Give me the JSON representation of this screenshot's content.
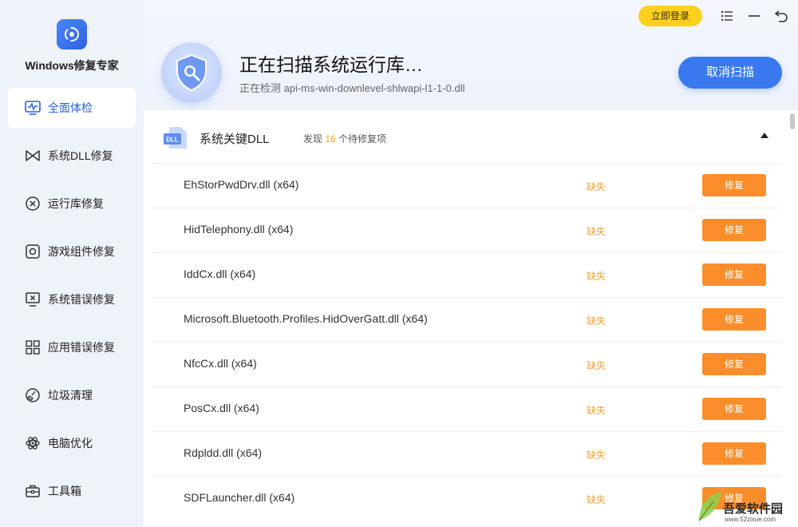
{
  "app": {
    "name": "Windows修复专家"
  },
  "sidebar": {
    "items": [
      {
        "label": "全面体检",
        "icon": "pulse-monitor-icon",
        "active": true
      },
      {
        "label": "系统DLL修复",
        "icon": "bowtie-icon"
      },
      {
        "label": "运行库修复",
        "icon": "circle-x-icon"
      },
      {
        "label": "游戏组件修复",
        "icon": "gear-square-icon"
      },
      {
        "label": "系统错误修复",
        "icon": "monitor-x-icon"
      },
      {
        "label": "应用错误修复",
        "icon": "apps-grid-icon"
      },
      {
        "label": "垃圾清理",
        "icon": "broom-icon"
      },
      {
        "label": "电脑优化",
        "icon": "atom-icon"
      },
      {
        "label": "工具箱",
        "icon": "toolbox-icon"
      }
    ]
  },
  "header": {
    "login_label": "立即登录",
    "scan_title": "正在扫描系统运行库…",
    "scan_sub": "正在检测 api-ms-win-downlevel-shlwapi-l1-1-0.dll",
    "cancel_label": "取消扫描"
  },
  "section": {
    "badge": "DLL",
    "title": "系统关键DLL",
    "found_prefix": "发现",
    "found_count": "16",
    "found_suffix": "个待修复项"
  },
  "rows": [
    {
      "name": "EhStorPwdDrv.dll (x64)",
      "status": "缺失",
      "action": "修复"
    },
    {
      "name": "HidTelephony.dll (x64)",
      "status": "缺失",
      "action": "修复"
    },
    {
      "name": "IddCx.dll (x64)",
      "status": "缺失",
      "action": "修复"
    },
    {
      "name": "Microsoft.Bluetooth.Profiles.HidOverGatt.dll (x64)",
      "status": "缺失",
      "action": "修复"
    },
    {
      "name": "NfcCx.dll (x64)",
      "status": "缺失",
      "action": "修复"
    },
    {
      "name": "PosCx.dll (x64)",
      "status": "缺失",
      "action": "修复"
    },
    {
      "name": "Rdpldd.dll (x64)",
      "status": "缺失",
      "action": "修复"
    },
    {
      "name": "SDFLauncher.dll (x64)",
      "status": "缺失",
      "action": "修复"
    }
  ],
  "watermark": {
    "text": "吾爱软件园",
    "url": "www.52zixue.com"
  },
  "colors": {
    "accent": "#3a78f0",
    "fix": "#fb8e2a",
    "login": "#fdd11d",
    "missing": "#f0a43a"
  }
}
